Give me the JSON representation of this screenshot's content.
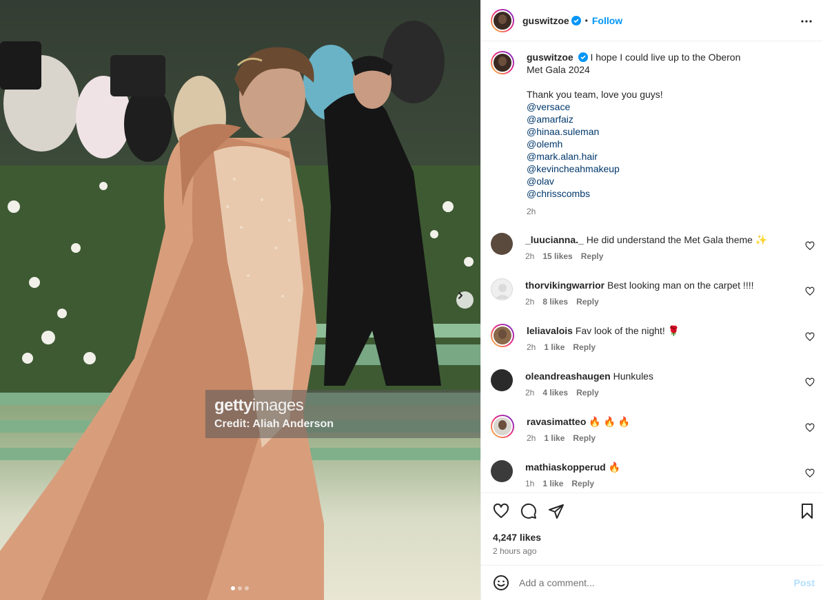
{
  "media": {
    "watermark_logo_a": "getty",
    "watermark_logo_b": "images",
    "watermark_credit": "Credit: Aliah Anderson",
    "carousel_dots": 3,
    "carousel_active_index": 0
  },
  "header": {
    "username": "guswitzoe",
    "separator": "•",
    "follow_label": "Follow"
  },
  "caption": {
    "username": "guswitzoe",
    "line1": "I hope I could live up to the Oberon Met Gala 2024",
    "line2": "Thank you team, love you guys!",
    "mentions": [
      "@versace",
      "@amarfaiz",
      "@hinaa.suleman",
      "@olemh",
      "@mark.alan.hair",
      "@kevincheahmakeup",
      "@olav",
      "@chrisscombs"
    ],
    "time": "2h"
  },
  "comments": [
    {
      "username": "_luucianna._",
      "text": "He did understand the Met Gala theme ✨",
      "time": "2h",
      "likes": "15 likes",
      "reply": "Reply",
      "avatar_color": "#5a4a3e"
    },
    {
      "username": "thorvikingwarrior",
      "text": "Best looking man on the carpet !!!!",
      "time": "2h",
      "likes": "8 likes",
      "reply": "Reply",
      "avatar_color": "#dbdbdb"
    },
    {
      "username": "leliavalois",
      "text": "Fav look of the night! 🌹",
      "time": "2h",
      "likes": "1 like",
      "reply": "Reply",
      "avatar_color": "#8a6a4a"
    },
    {
      "username": "oleandreashaugen",
      "text": "Hunkules",
      "time": "2h",
      "likes": "4 likes",
      "reply": "Reply",
      "avatar_color": "#2a2a2a"
    },
    {
      "username": "ravasimatteo",
      "text": "🔥 🔥 🔥",
      "time": "2h",
      "likes": "1 like",
      "reply": "Reply",
      "avatar_color": "#d9d6d0"
    },
    {
      "username": "mathiaskopperud",
      "text": "🔥",
      "time": "1h",
      "likes": "1 like",
      "reply": "Reply",
      "avatar_color": "#3b3b3b"
    }
  ],
  "actions": {
    "likes": "4,247 likes",
    "posted": "2 hours ago"
  },
  "add_comment": {
    "placeholder": "Add a comment...",
    "post_label": "Post"
  },
  "icons": {
    "verified": "verified-badge-icon",
    "more": "more-options-icon",
    "like": "heart-icon",
    "comment": "comment-bubble-icon",
    "share": "paper-plane-icon",
    "save": "bookmark-icon",
    "emoji": "smiley-face-icon",
    "next": "chevron-right-icon"
  },
  "colors": {
    "accent": "#0095f6",
    "mention": "#00376b",
    "muted": "#737373",
    "post_disabled": "#b2dffc"
  }
}
